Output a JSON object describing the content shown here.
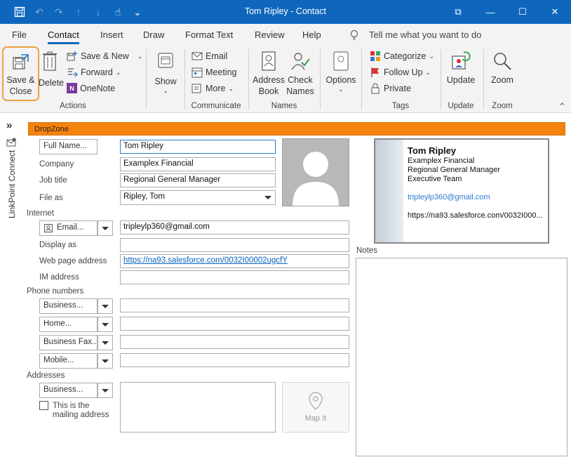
{
  "window": {
    "title": "Tom Ripley  -  Contact",
    "controls": {
      "restore": "⧉",
      "minimize": "—",
      "maximize": "☐",
      "close": "✕"
    }
  },
  "quick_access": {
    "save": "💾",
    "undo": "↶",
    "redo": "↷",
    "up": "↑",
    "down": "↓",
    "touch": "☝",
    "more": "⌄"
  },
  "menu": {
    "tabs": [
      "File",
      "Contact",
      "Insert",
      "Draw",
      "Format Text",
      "Review",
      "Help"
    ],
    "active": "Contact",
    "tell_me": "Tell me what you want to do"
  },
  "ribbon": {
    "actions": {
      "save_close": "Save &\nClose",
      "delete": "Delete",
      "save_new": "Save & New",
      "forward": "Forward",
      "onenote": "OneNote",
      "group": "Actions"
    },
    "show": {
      "label": "Show"
    },
    "communicate": {
      "email": "Email",
      "meeting": "Meeting",
      "more": "More",
      "group": "Communicate"
    },
    "names": {
      "address_book": "Address\nBook",
      "check_names": "Check\nNames",
      "group": "Names"
    },
    "options": {
      "label": "Options"
    },
    "tags": {
      "categorize": "Categorize",
      "follow_up": "Follow Up",
      "private": "Private",
      "group": "Tags"
    },
    "update": {
      "label": "Update",
      "group": "Update"
    },
    "zoom": {
      "label": "Zoom",
      "group": "Zoom"
    },
    "collapse": "⌃"
  },
  "rail": {
    "label": "LinkPoint Connect",
    "expand": "»"
  },
  "form": {
    "dropzone": "DropZone",
    "full_name_btn": "Full Name...",
    "full_name": "Tom Ripley",
    "company_label": "Company",
    "company": "Examplex Financial",
    "job_title_label": "Job title",
    "job_title": "Regional General Manager",
    "file_as_label": "File as",
    "file_as": "Ripley, Tom",
    "internet_header": "Internet",
    "email_btn": "Email...",
    "email": "tripleylp360@gmail.com",
    "display_as_label": "Display as",
    "display_as": "",
    "web_label": "Web page address",
    "web": "https://na93.salesforce.com/0032I00002ugcfY",
    "im_label": "IM address",
    "im": "",
    "phone_header": "Phone numbers",
    "phones": [
      {
        "label": "Business...",
        "value": ""
      },
      {
        "label": "Home...",
        "value": ""
      },
      {
        "label": "Business Fax..",
        "value": ""
      },
      {
        "label": "Mobile...",
        "value": ""
      }
    ],
    "addresses_header": "Addresses",
    "address_btn": "Business...",
    "mailing_check": "This is the\nmailing address",
    "map_it": "Map It",
    "notes_label": "Notes"
  },
  "business_card": {
    "name": "Tom Ripley",
    "company": "Examplex Financial",
    "title": "Regional General Manager",
    "department": "Executive Team",
    "email": "tripleylp360@gmail.com",
    "web": "https://na93.salesforce.com/0032I000..."
  },
  "colors": {
    "titlebar": "#0f67bd",
    "accent_orange": "#f5830c",
    "highlight_ring": "#f0a040",
    "link": "#0563c1"
  }
}
